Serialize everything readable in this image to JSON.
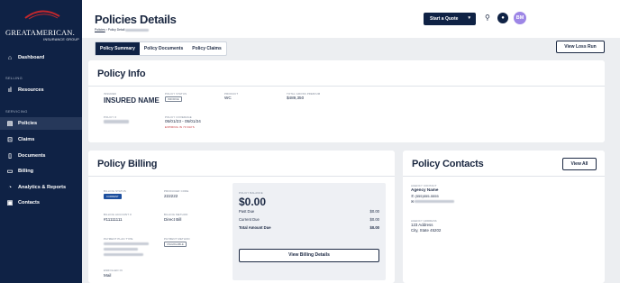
{
  "brand": {
    "name": "GREATAMERICAN.",
    "sub": "INSURANCE GROUP",
    "arc_color": "#c0272d"
  },
  "sidebar": {
    "items": [
      {
        "label": "Dashboard",
        "icon": "home-icon"
      },
      {
        "label": "Resources",
        "icon": "bar-chart-icon"
      },
      {
        "label": "Policies",
        "icon": "policy-icon"
      },
      {
        "label": "Claims",
        "icon": "claims-icon"
      },
      {
        "label": "Documents",
        "icon": "document-icon"
      },
      {
        "label": "Billing",
        "icon": "credit-card-icon"
      },
      {
        "label": "Analytics & Reports",
        "icon": "analytics-icon"
      },
      {
        "label": "Contacts",
        "icon": "contacts-icon"
      }
    ],
    "sections": {
      "selling": "SELLING",
      "servicing": "SERVICING"
    }
  },
  "header": {
    "title": "Policies Details",
    "breadcrumb_link": "Policies",
    "breadcrumb_sep": "›",
    "breadcrumb_current": "Policy Detail",
    "start_quote": "Start a Quote",
    "avatar_initials": "BM"
  },
  "tabs": [
    "Policy Summary",
    "Policy Documents",
    "Policy Claims"
  ],
  "loss_run": "View Loss Run",
  "policy_info": {
    "title": "Policy Info",
    "insured_label": "INSURED",
    "insured_value": "INSURED NAME",
    "status_label": "POLICY STATUS",
    "status_value": "INFORCE",
    "product_label": "PRODUCT",
    "product_value": "WC",
    "premium_label": "TOTAL GROSS PREMIUM",
    "premium_value": "$489,350",
    "policy_num_label": "POLICY #",
    "coverage_label": "POLICY COVERAGE",
    "coverage_value": "05/01/23 - 05/01/24",
    "expiring": "EXPIRING IN 73 DAYS"
  },
  "billing": {
    "title": "Policy Billing",
    "status_label": "BILLING STATUS",
    "status_value": "CURRENT",
    "producer_label": "PRODUCER CODE",
    "producer_value": "222222",
    "account_label": "BILLING ACCOUNT #",
    "account_value": "#11111111",
    "method_label": "BILLING METHOD",
    "method_value": "Direct Bill",
    "plan_label": "PAYMENT PLAN TYPE",
    "payment_method_label": "PAYMENT METHOD",
    "payment_method_value": "UNAVAILABLE",
    "enrolled_label": "ENROLLED IN",
    "enrolled_value": "Mail",
    "balance_label": "POLICY BALANCE",
    "balance_value": "$0.00",
    "rows": [
      {
        "label": "Past Due",
        "value": "$0.00"
      },
      {
        "label": "Current Due",
        "value": "$0.00"
      },
      {
        "label": "Total Amount Due",
        "value": "$0.00"
      }
    ],
    "details_button": "View Billing Details"
  },
  "contacts": {
    "title": "Policy Contacts",
    "view_all": "View All",
    "agency_contact_label": "AGENCY CONTACT",
    "agency_name": "Agency Name",
    "agency_phone": "(555)555-5555",
    "agency_address_label": "AGENCY ADDRESS",
    "address_line1": "123 Address",
    "address_line2": "City, State 45202"
  }
}
